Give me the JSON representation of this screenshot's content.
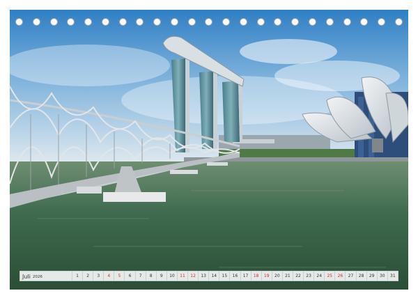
{
  "calendar": {
    "month": "Juli",
    "year": "2026",
    "days": [
      {
        "n": "1",
        "weekend": false
      },
      {
        "n": "2",
        "weekend": false
      },
      {
        "n": "3",
        "weekend": false
      },
      {
        "n": "4",
        "weekend": true
      },
      {
        "n": "5",
        "weekend": true
      },
      {
        "n": "6",
        "weekend": false
      },
      {
        "n": "7",
        "weekend": false
      },
      {
        "n": "8",
        "weekend": false
      },
      {
        "n": "9",
        "weekend": false
      },
      {
        "n": "10",
        "weekend": false
      },
      {
        "n": "11",
        "weekend": true
      },
      {
        "n": "12",
        "weekend": true
      },
      {
        "n": "13",
        "weekend": false
      },
      {
        "n": "14",
        "weekend": false
      },
      {
        "n": "15",
        "weekend": false
      },
      {
        "n": "16",
        "weekend": false
      },
      {
        "n": "17",
        "weekend": false
      },
      {
        "n": "18",
        "weekend": true
      },
      {
        "n": "19",
        "weekend": true
      },
      {
        "n": "20",
        "weekend": false
      },
      {
        "n": "21",
        "weekend": false
      },
      {
        "n": "22",
        "weekend": false
      },
      {
        "n": "23",
        "weekend": false
      },
      {
        "n": "24",
        "weekend": false
      },
      {
        "n": "25",
        "weekend": true
      },
      {
        "n": "26",
        "weekend": true
      },
      {
        "n": "27",
        "weekend": false
      },
      {
        "n": "28",
        "weekend": false
      },
      {
        "n": "29",
        "weekend": false
      },
      {
        "n": "30",
        "weekend": false
      },
      {
        "n": "31",
        "weekend": false
      }
    ],
    "weekend_color": "#d4282c"
  },
  "binding": {
    "hole_count": 23
  },
  "photo": {
    "subject": "marina-bay-helix-bridge"
  }
}
